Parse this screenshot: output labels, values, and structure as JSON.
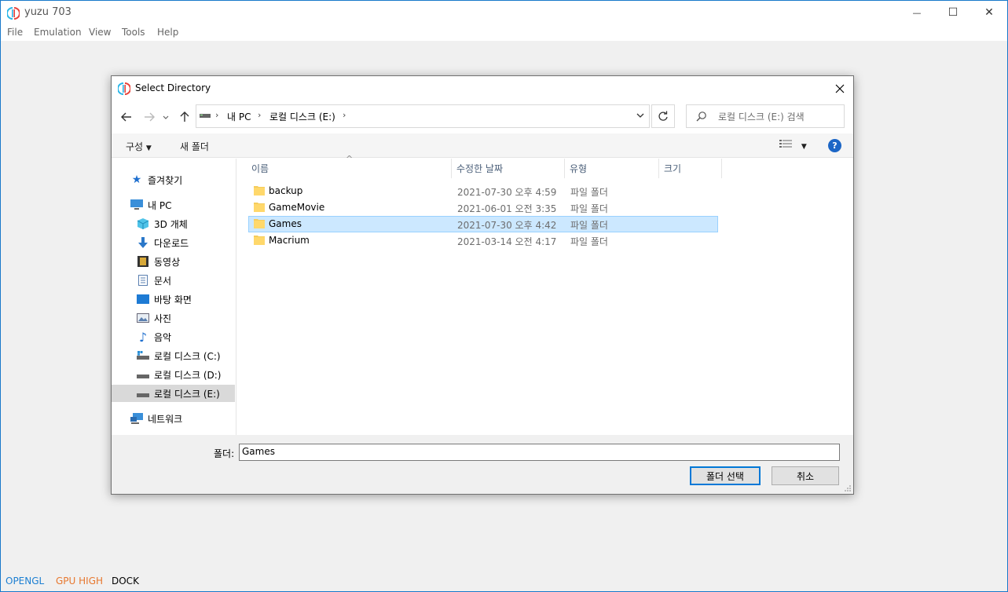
{
  "app": {
    "title": "yuzu 703"
  },
  "window_controls": {
    "minimize": "—",
    "maximize": "☐",
    "close": "✕"
  },
  "menu": [
    "File",
    "Emulation",
    "View",
    "Tools",
    "Help"
  ],
  "statusbar": {
    "items": [
      {
        "label": "OPENGL",
        "color": "#1c7fd2"
      },
      {
        "label": "GPU HIGH",
        "color": "#e7772e"
      },
      {
        "label": "DOCK",
        "color": "#000000"
      }
    ]
  },
  "dialog": {
    "title": "Select Directory",
    "address": {
      "segments": [
        "내 PC",
        "로컬 디스크 (E:)"
      ]
    },
    "search_placeholder": "로컬 디스크 (E:) 검색",
    "toolbar": {
      "organize": "구성",
      "new_folder": "새 폴더",
      "help": "?"
    },
    "nav": {
      "quick_access": "즐겨찾기",
      "this_pc": "내 PC",
      "items": [
        "3D 개체",
        "다운로드",
        "동영상",
        "문서",
        "바탕 화면",
        "사진",
        "음악",
        "로컬 디스크 (C:)",
        "로컬 디스크 (D:)",
        "로컬 디스크 (E:)"
      ],
      "network": "네트워크"
    },
    "columns": {
      "name": "이름",
      "modified": "수정한 날짜",
      "type": "유형",
      "size": "크기"
    },
    "files": [
      {
        "name": "backup",
        "modified": "2021-07-30 오후 4:59",
        "type": "파일 폴더"
      },
      {
        "name": "GameMovie",
        "modified": "2021-06-01 오전 3:35",
        "type": "파일 폴더"
      },
      {
        "name": "Games",
        "modified": "2021-07-30 오후 4:42",
        "type": "파일 폴더",
        "selected": true
      },
      {
        "name": "Macrium",
        "modified": "2021-03-14 오전 4:17",
        "type": "파일 폴더"
      }
    ],
    "folder_label": "폴더:",
    "folder_value": "Games",
    "select_button": "폴더 선택",
    "cancel_button": "취소"
  }
}
